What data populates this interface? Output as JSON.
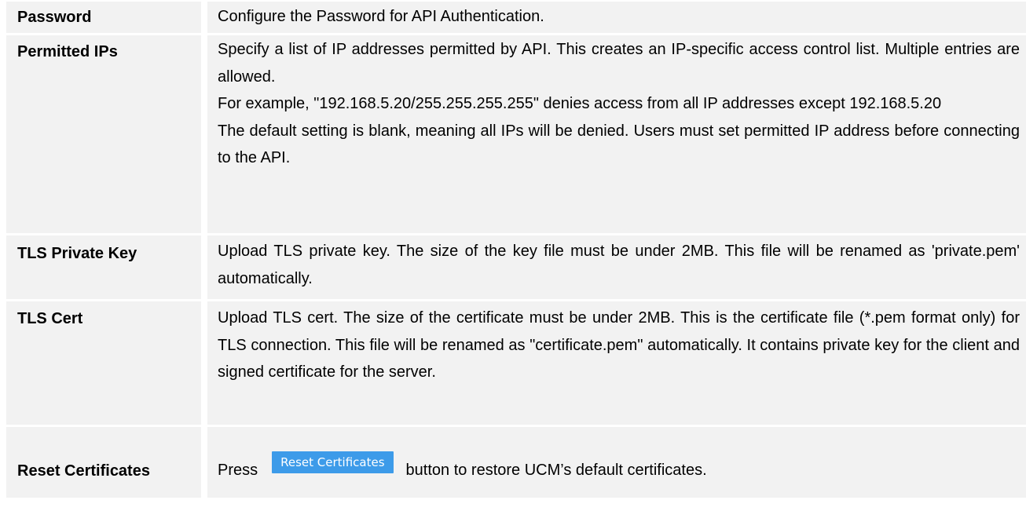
{
  "rows": [
    {
      "label": "Password",
      "lines": [
        "Configure the Password for API Authentication."
      ]
    },
    {
      "label": "Permitted IPs",
      "lines": [
        "Specify a list of IP addresses permitted by API. This creates an IP-specific access control list. Multiple entries are allowed.",
        "For example, \"192.168.5.20/255.255.255.255\" denies access from all IP addresses except 192.168.5.20",
        "The default setting is blank, meaning all IPs will be denied. Users must set permitted IP address before connecting to the API."
      ]
    },
    {
      "label": "TLS Private Key",
      "lines": [
        "Upload TLS private key. The size of the key file must be under 2MB. This file will be renamed as 'private.pem' automatically."
      ]
    },
    {
      "label": "TLS Cert",
      "lines": [
        "Upload TLS cert. The size of the certificate must be under 2MB. This is the certificate file (*.pem format only) for TLS connection. This file will be renamed as \"certificate.pem\" automatically. It contains private key for the client and signed certificate for the server."
      ]
    },
    {
      "label": "Reset Certificates",
      "press_text": "Press",
      "button_label": "Reset Certificates",
      "after_text": "button to restore UCM’s default certificates."
    }
  ],
  "colors": {
    "row_bg": "#f2f2f2",
    "button_bg": "#3d9be9",
    "button_text": "#ffffff"
  }
}
